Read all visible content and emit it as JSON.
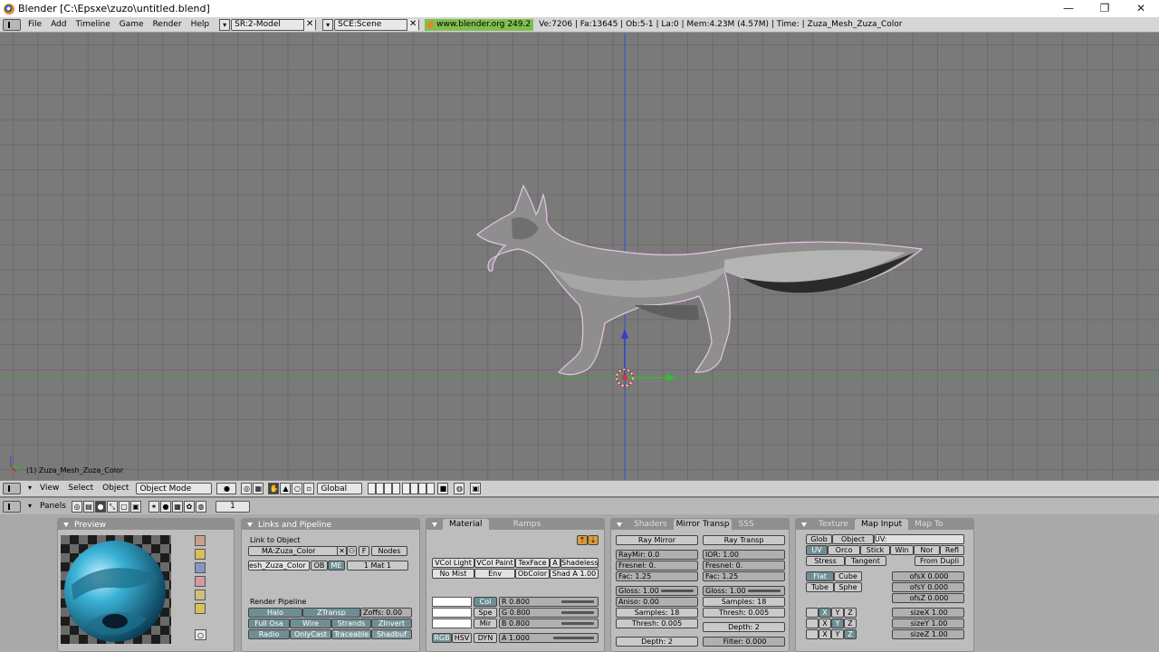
{
  "window": {
    "title": "Blender [C:\\Epsxe\\zuzo\\untitled.blend]",
    "minimize": "—",
    "maximize": "❐",
    "close": "✕"
  },
  "info_header": {
    "menus": [
      "File",
      "Add",
      "Timeline",
      "Game",
      "Render",
      "Help"
    ],
    "screen_field": "SR:2-Model",
    "scene_field": "SCE:Scene",
    "website": "www.blender.org 249.2",
    "stats": "Ve:7206 | Fa:13645 | Ob:5-1 | La:0  | Mem:4.23M (4.57M)  | Time:  | Zuza_Mesh_Zuza_Color"
  },
  "viewport": {
    "object_label": "(1) Zuza_Mesh_Zuza_Color"
  },
  "view3d_header": {
    "menus": [
      "View",
      "Select",
      "Object"
    ],
    "mode": "Object Mode",
    "orientation": "Global"
  },
  "buttons_header": {
    "panels_label": "Panels",
    "frame": "1"
  },
  "preview_panel": {
    "title": "Preview"
  },
  "links_panel": {
    "title": "Links and Pipeline",
    "link_to_object": "Link to Object",
    "material_field": "MA:Zuza_Color",
    "f_button": "F",
    "nodes_button": "Nodes",
    "mesh_field": "esh_Zuza_Color",
    "ob_button": "OB",
    "me_button": "ME",
    "mat_field": "1 Mat 1",
    "render_pipeline": "Render Pipeline",
    "halo": "Halo",
    "ztransp": "ZTransp",
    "zoffs": "Zoffs: 0.00",
    "full_osa": "Full Osa",
    "wire": "Wire",
    "strands": "Strands",
    "zinvert": "ZInvert",
    "radio": "Radio",
    "onlycast": "OnlyCast",
    "traceable": "Traceable",
    "shadbuf": "Shadbuf"
  },
  "material_panel": {
    "tab_material": "Material",
    "tab_ramps": "Ramps",
    "vcol_light": "VCol Light",
    "vcol_paint": "VCol Paint",
    "texface": "TexFace",
    "a_btn": "A",
    "shadeless": "Shadeless",
    "no_mist": "No Mist",
    "env": "Env",
    "obcolor": "ObColor",
    "shad_a": "Shad A 1.00",
    "col": "Col",
    "spe": "Spe",
    "mir": "Mir",
    "r": "R 0.800",
    "g": "G 0.800",
    "b": "B 0.800",
    "rgb": "RGB",
    "hsv": "HSV",
    "dyn": "DYN",
    "alpha": "A 1.000"
  },
  "shaders_panel": {
    "tab_shaders": "Shaders",
    "tab_mirror": "Mirror Transp",
    "tab_sss": "SSS",
    "ray_mirror": "Ray Mirror",
    "raymir": "RayMir: 0.0",
    "fresnel_l": "Fresnel: 0.",
    "fac_l": "Fac: 1.25",
    "gloss_l": "Gloss: 1.00",
    "aniso": "Aniso: 0.00",
    "samples_l": "Samples: 18",
    "thresh_l": "Thresh: 0.005",
    "depth_l": "Depth: 2",
    "ray_transp": "Ray Transp",
    "ior": "IOR: 1.00",
    "fresnel_r": "Fresnel: 0.",
    "fac_r": "Fac: 1.25",
    "gloss_r": "Gloss: 1.00",
    "samples_r": "Samples: 18",
    "thresh_r": "Thresh: 0.005",
    "depth_r": "Depth: 2",
    "filter": "Filter: 0.000"
  },
  "texture_panel": {
    "tab_texture": "Texture",
    "tab_mapinput": "Map Input",
    "tab_mapto": "Map To",
    "glob": "Glob",
    "object": "Object",
    "uv_label": "UV:",
    "uv": "UV",
    "orco": "Orco",
    "stick": "Stick",
    "win": "Win",
    "nor": "Nor",
    "refl": "Refl",
    "stress": "Stress",
    "tangent": "Tangent",
    "from_dupli": "From Dupli",
    "flat": "Flat",
    "cube": "Cube",
    "tube": "Tube",
    "sphe": "Sphe",
    "ofsx": "ofsX 0.000",
    "ofsy": "ofsY 0.000",
    "ofsz": "ofsZ 0.000",
    "sizex": "sizeX 1.00",
    "sizey": "sizeY 1.00",
    "sizez": "sizeZ 1.00",
    "x": "X",
    "y": "Y",
    "z": "Z"
  }
}
